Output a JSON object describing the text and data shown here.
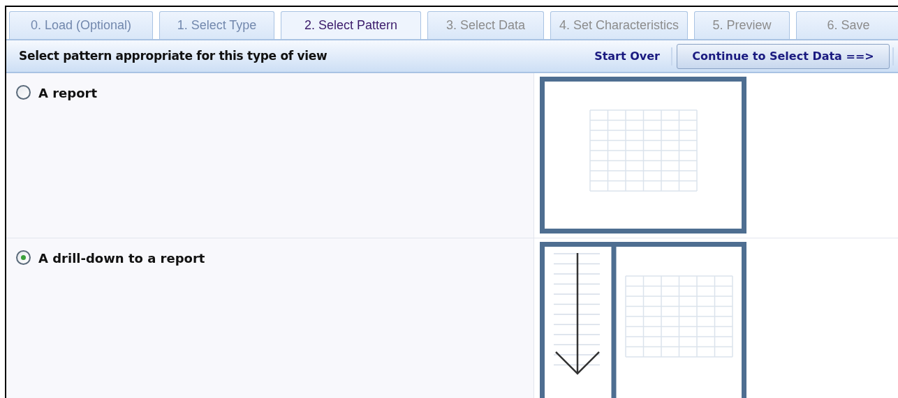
{
  "tabs": [
    {
      "label": "0. Load (Optional)",
      "selected": false,
      "disabled": false
    },
    {
      "label": "1. Select Type",
      "selected": false,
      "disabled": false
    },
    {
      "label": "2. Select Pattern",
      "selected": true,
      "disabled": false
    },
    {
      "label": "3. Select Data",
      "selected": false,
      "disabled": true
    },
    {
      "label": "4. Set Characteristics",
      "selected": false,
      "disabled": true
    },
    {
      "label": "5. Preview",
      "selected": false,
      "disabled": true
    },
    {
      "label": "6. Save",
      "selected": false,
      "disabled": true
    }
  ],
  "toolbar": {
    "instruction": "Select pattern appropriate for this type of view",
    "start_over": "Start Over",
    "continue_button": "Continue to Select Data ==>"
  },
  "patterns": [
    {
      "label": "A report",
      "selected": false,
      "kind": "report"
    },
    {
      "label": "A drill-down to a report",
      "selected": true,
      "kind": "drilldown"
    }
  ]
}
